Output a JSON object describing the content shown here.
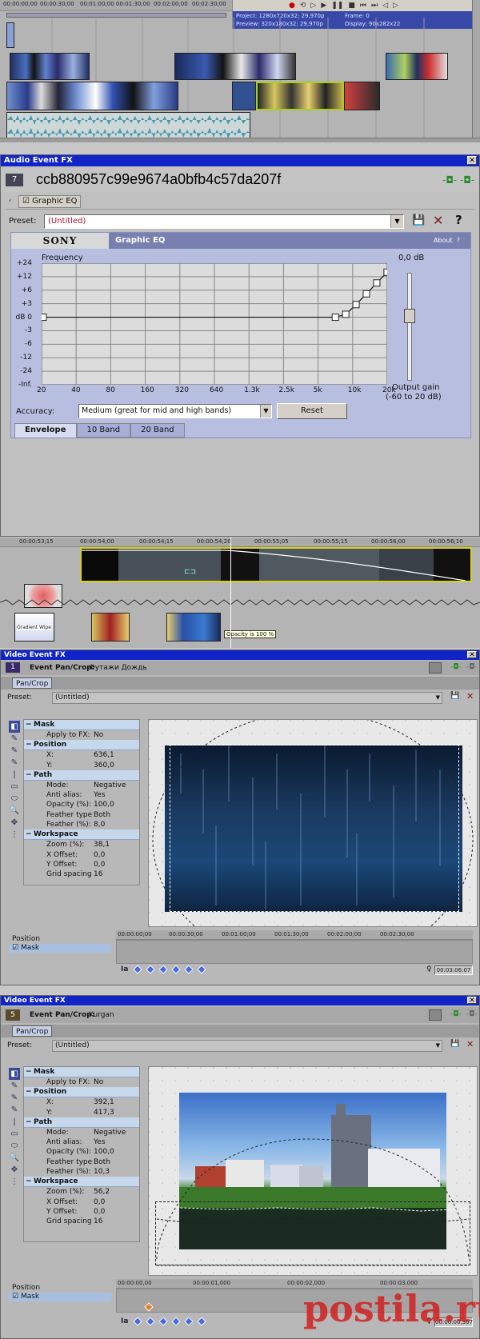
{
  "timeline_top": {
    "ruler_ticks": [
      "00:00:00;00",
      "00:00:30;00",
      "00:01:00;00",
      "00:01:30;00",
      "00:02:00;00",
      "00:02:30;00"
    ],
    "project_label": "Project:",
    "project_value": "1280x720x32; 29,970p",
    "preview_label": "Preview:",
    "preview_value": "320x180x32; 29,970p",
    "frame_label": "Frame:",
    "frame_value": "0",
    "display_label": "Display:",
    "display_value": "90x282x22"
  },
  "audio_fx": {
    "title": "Audio Event FX",
    "close": "✕",
    "chain_number": "7",
    "event_name": "ccb880957c99e9674a0bfb4c57da207f",
    "plugin_tab": "Graphic EQ",
    "preset_label": "Preset:",
    "preset_value": "(Untitled)",
    "help": "?",
    "brand": "SONY",
    "plugin_name": "Graphic EQ",
    "about": "About",
    "about_q": "?",
    "frequency_label": "Frequency",
    "db_labels": [
      "+24",
      "+12",
      "+6",
      "+3",
      "dB 0",
      "-3",
      "-6",
      "-12",
      "-24",
      "-Inf."
    ],
    "freq_labels": [
      "20",
      "40",
      "80",
      "160",
      "320",
      "640",
      "1.3k",
      "2.5k",
      "5k",
      "10k",
      "20k"
    ],
    "output_gain_value": "0,0 dB",
    "output_gain_label": "Output gain",
    "output_gain_range": "(-60 to 20 dB)",
    "accuracy_label": "Accuracy:",
    "accuracy_value": "Medium (great for mid and high bands)",
    "reset": "Reset",
    "tabs": [
      "Envelope",
      "10 Band",
      "20 Band"
    ],
    "eq_points_db": [
      0,
      0,
      0,
      0,
      0,
      0,
      0,
      0,
      0,
      0.8,
      3.5,
      6.5,
      9.5,
      12.5
    ]
  },
  "timeline_mid": {
    "ruler_ticks": [
      "00:00:53;15",
      "00:00:54;00",
      "00:00:54;15",
      "00:00:54;20",
      "00:00:55;05",
      "00:00:55;15",
      "00:00:56;00",
      "00:00:56;10"
    ],
    "transition_label": "Gradient Wipe",
    "tooltip": "Opacity is 100 %"
  },
  "video_fx_1": {
    "title": "Video Event FX",
    "close": "✕",
    "chain_number": "1",
    "chain_label": "Event Pan/Crop:",
    "chain_name": "Футажи Дождь",
    "tab": "Pan/Crop",
    "preset_label": "Preset:",
    "preset_value": "(Untitled)",
    "sections": [
      {
        "name": "Mask",
        "rows": [
          [
            "Apply to FX:",
            "No"
          ]
        ]
      },
      {
        "name": "Position",
        "rows": [
          [
            "X:",
            "636,1"
          ],
          [
            "Y:",
            "360,0"
          ]
        ]
      },
      {
        "name": "Path",
        "rows": [
          [
            "Mode:",
            "Negative"
          ],
          [
            "Anti alias:",
            "Yes"
          ],
          [
            "Opacity (%):",
            "100,0"
          ],
          [
            "Feather type:",
            "Both"
          ],
          [
            "Feather (%):",
            "8,0"
          ]
        ]
      },
      {
        "name": "Workspace",
        "rows": [
          [
            "Zoom (%):",
            "38,1"
          ],
          [
            "X Offset:",
            "0,0"
          ],
          [
            "Y Offset:",
            "0,0"
          ],
          [
            "Grid spacing:",
            "16"
          ]
        ]
      }
    ],
    "track_labels": [
      "Position",
      "Mask"
    ],
    "ruler_ticks": [
      "00:00:00;00",
      "00:00:30;00",
      "00:01:00;00",
      "00:01:30;00",
      "00:02:00;00",
      "00:02:30;00"
    ],
    "time": "00:03:06:07"
  },
  "video_fx_2": {
    "title": "Video Event FX",
    "close": "✕",
    "chain_number": "5",
    "chain_label": "Event Pan/Crop:",
    "chain_name": "Kurgan",
    "tab": "Pan/Crop",
    "preset_label": "Preset:",
    "preset_value": "(Untitled)",
    "sections": [
      {
        "name": "Mask",
        "rows": [
          [
            "Apply to FX:",
            "No"
          ]
        ]
      },
      {
        "name": "Position",
        "rows": [
          [
            "X:",
            "392,1"
          ],
          [
            "Y:",
            "417,3"
          ]
        ]
      },
      {
        "name": "Path",
        "rows": [
          [
            "Mode:",
            "Negative"
          ],
          [
            "Anti alias:",
            "Yes"
          ],
          [
            "Opacity (%):",
            "100,0"
          ],
          [
            "Feather type:",
            "Both"
          ],
          [
            "Feather (%):",
            "10,3"
          ]
        ]
      },
      {
        "name": "Workspace",
        "rows": [
          [
            "Zoom (%):",
            "56,2"
          ],
          [
            "X Offset:",
            "0,0"
          ],
          [
            "Y Offset:",
            "0,0"
          ],
          [
            "Grid spacing:",
            "16"
          ]
        ]
      }
    ],
    "track_labels": [
      "Position",
      "Mask"
    ],
    "ruler_ticks": [
      "00:00:00,00",
      "00:00:01,000",
      "00:00:02,000",
      "00:00:03,000"
    ],
    "time": "00:00:00,367"
  },
  "watermark": "postila.ru",
  "colors": {
    "title_bar": "#1024c8",
    "eq_bg": "#dcdcdc",
    "prop_header": "#c8d8ec",
    "accent_green": "#a8d020"
  }
}
